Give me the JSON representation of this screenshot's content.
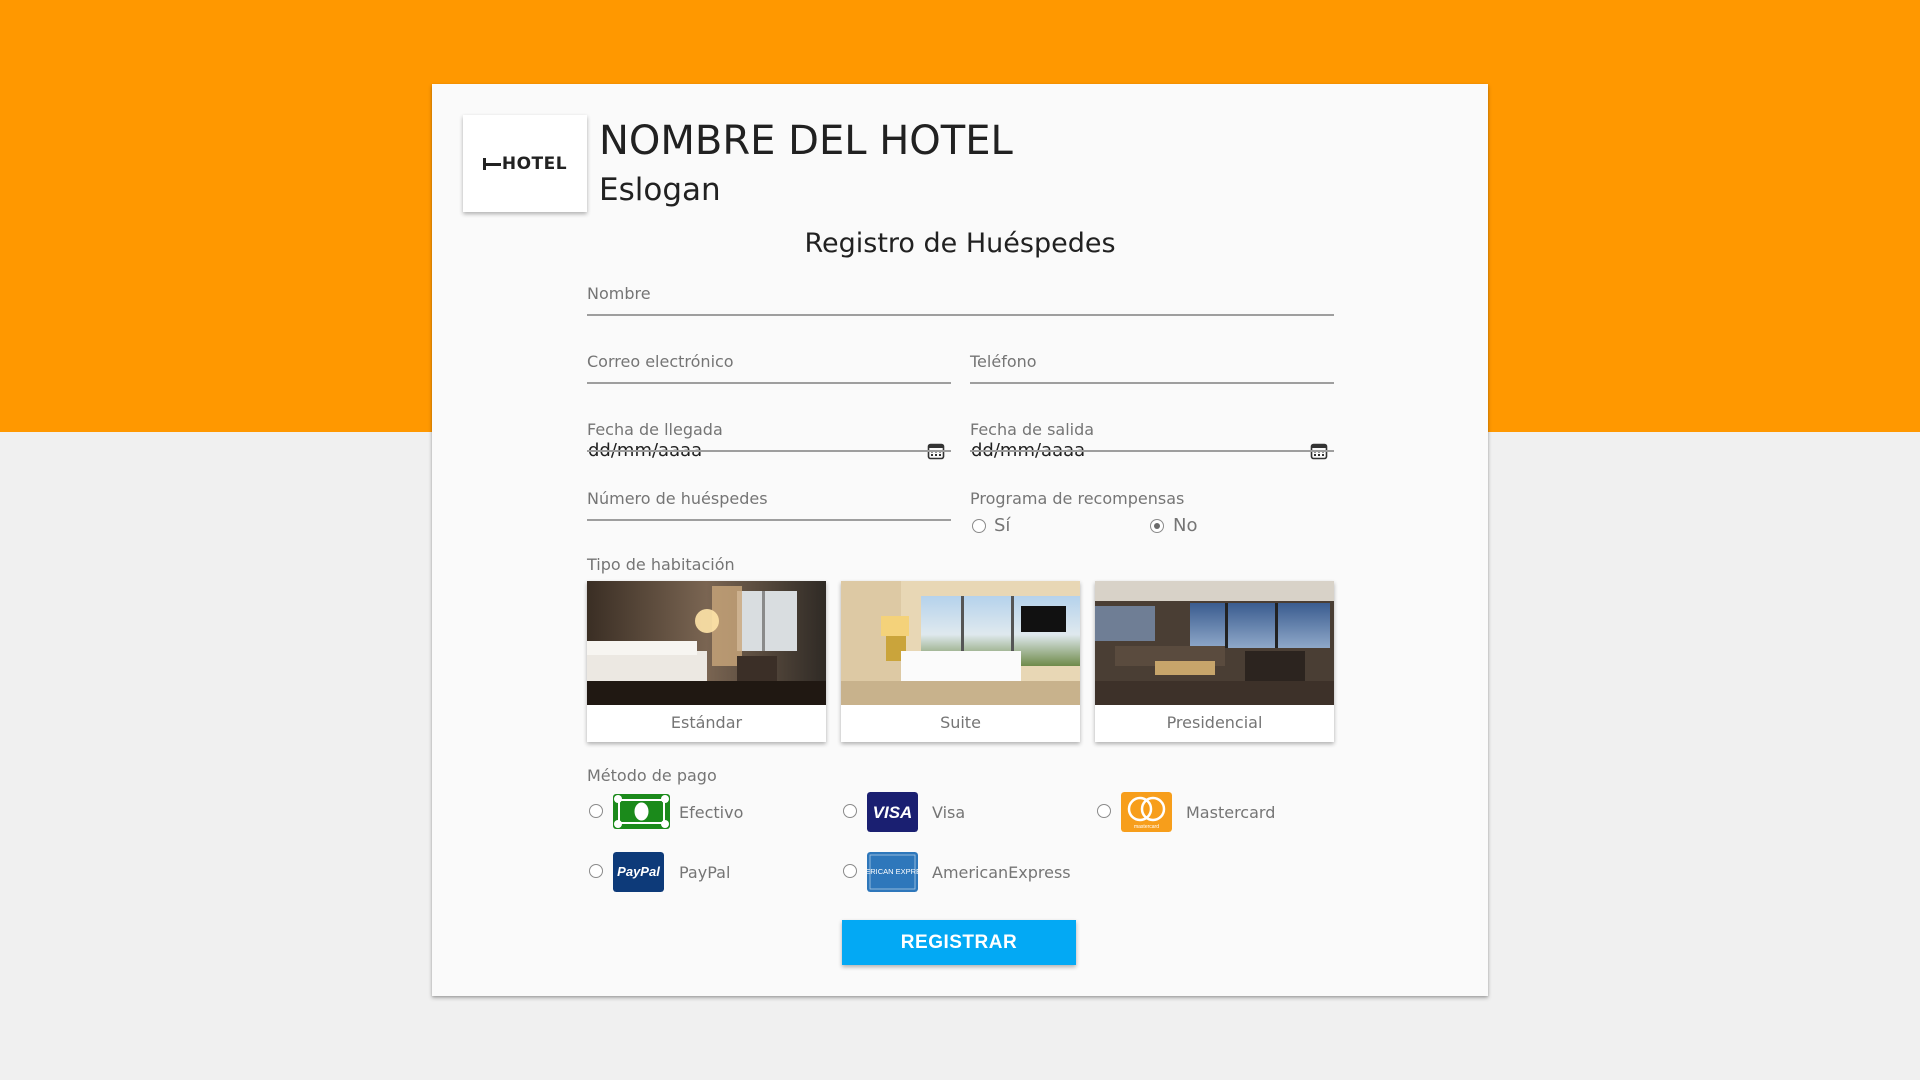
{
  "brand": {
    "logo_text": "HOTEL",
    "hotel_name": "NOMBRE DEL HOTEL",
    "slogan": "Eslogan",
    "colors": {
      "accent": "#ff9800",
      "button": "#03a9f4",
      "card": "#fafafa",
      "page": "#f0f0f0"
    }
  },
  "form": {
    "title": "Registro de Huéspedes",
    "name_label": "Nombre",
    "email_label": "Correo electrónico",
    "phone_label": "Teléfono",
    "arrival_label": "Fecha de llegada",
    "arrival_value": "dd/mm/aaaa",
    "departure_label": "Fecha de salida",
    "departure_value": "dd/mm/aaaa",
    "guests_label": "Número de huéspedes",
    "rewards_label": "Programa de recompensas",
    "rewards_options": [
      {
        "label": "Sí",
        "checked": false
      },
      {
        "label": "No",
        "checked": true
      }
    ],
    "room_label": "Tipo de habitación",
    "rooms": [
      {
        "label": "Estándar"
      },
      {
        "label": "Suite"
      },
      {
        "label": "Presidencial"
      }
    ],
    "payment_label": "Método de pago",
    "payments": [
      {
        "label": "Efectivo",
        "icon": "cash-icon"
      },
      {
        "label": "Visa",
        "icon": "visa-icon",
        "icon_text": "VISA"
      },
      {
        "label": "Mastercard",
        "icon": "mastercard-icon",
        "icon_text": "mastercard"
      },
      {
        "label": "PayPal",
        "icon": "paypal-icon",
        "icon_text": "PayPal"
      },
      {
        "label": "AmericanExpress",
        "icon": "amex-icon",
        "icon_text": "AMERICAN EXPRESS"
      }
    ],
    "submit_label": "REGISTRAR"
  }
}
